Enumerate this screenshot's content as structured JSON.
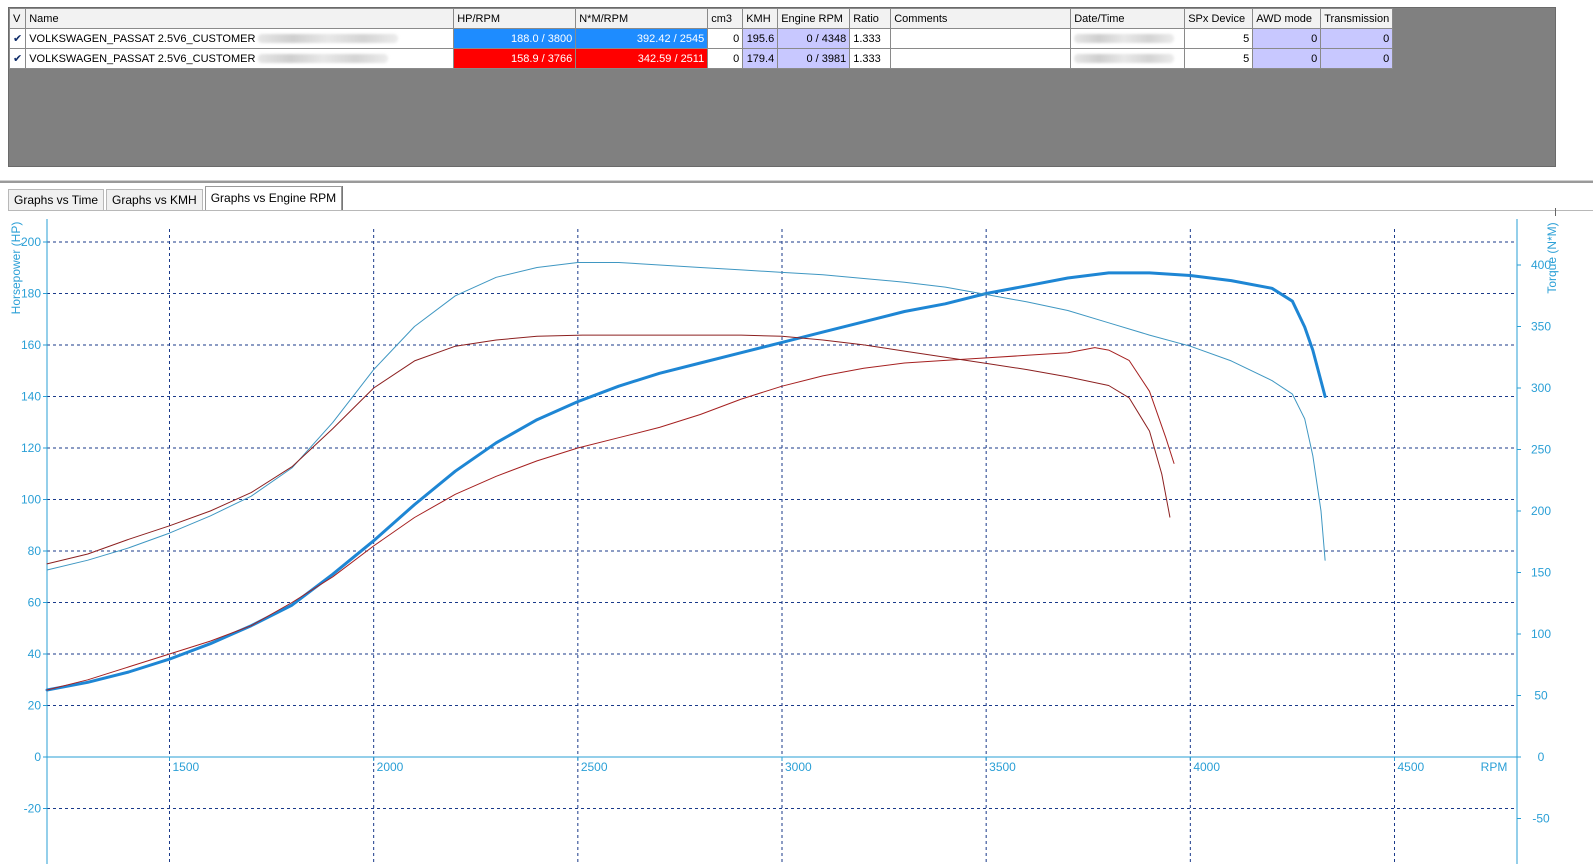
{
  "table": {
    "headers": [
      "V",
      "Name",
      "HP/RPM",
      "N*M/RPM",
      "cm3",
      "KMH",
      "Engine RPM",
      "Ratio",
      "Comments",
      "Date/Time",
      "SPx Device",
      "AWD mode",
      "Transmission"
    ],
    "rows": [
      {
        "checked": "✔",
        "name": "VOLKSWAGEN_PASSAT 2.5V6_CUSTOMER",
        "hp_rpm": "188.0 / 3800",
        "nm_rpm": "392.42 / 2545",
        "cm3": "0",
        "kmh": "195.6",
        "engine_rpm": "0 / 4348",
        "ratio": "1.333",
        "comments": "",
        "spx_device": "5",
        "awd_mode": "0",
        "transmission": "0",
        "color": "#1e8cff"
      },
      {
        "checked": "✔",
        "name": "VOLKSWAGEN_PASSAT 2.5V6_CUSTOMER",
        "hp_rpm": "158.9 / 3766",
        "nm_rpm": "342.59 / 2511",
        "cm3": "0",
        "kmh": "179.4",
        "engine_rpm": "0 / 3981",
        "ratio": "1.333",
        "comments": "",
        "spx_device": "5",
        "awd_mode": "0",
        "transmission": "0",
        "color": "#ff0000"
      }
    ]
  },
  "tabs": [
    {
      "label": "Graphs vs Time",
      "active": false
    },
    {
      "label": "Graphs vs KMH",
      "active": false
    },
    {
      "label": "Graphs vs Engine RPM",
      "active": true
    }
  ],
  "chart_data": {
    "type": "line",
    "xlabel": "RPM",
    "ylabel_left": "Horsepower (HP)",
    "ylabel_right": "Torque (N*M)",
    "xlim": [
      1200,
      4800
    ],
    "ylim_left": [
      -35,
      205
    ],
    "ylim_right": [
      -70,
      425
    ],
    "x_ticks": [
      "1500",
      "2000",
      "2500",
      "3000",
      "3500",
      "4000",
      "4500"
    ],
    "y_ticks_left": [
      "-20",
      "0",
      "20",
      "40",
      "60",
      "80",
      "100",
      "120",
      "140",
      "160",
      "180",
      "200"
    ],
    "y_ticks_right": [
      "-50",
      "0",
      "50",
      "100",
      "150",
      "200",
      "250",
      "300",
      "350",
      "400"
    ],
    "grid": true,
    "grid_color": "#1a3a8a",
    "axis_text_color": "#2a9fd6",
    "series": [
      {
        "axis": "left",
        "color": "#1e86d4",
        "width": 3,
        "points": [
          [
            1200,
            26
          ],
          [
            1300,
            29
          ],
          [
            1400,
            33
          ],
          [
            1500,
            38
          ],
          [
            1600,
            44
          ],
          [
            1700,
            51
          ],
          [
            1800,
            59
          ],
          [
            1900,
            71
          ],
          [
            2000,
            84
          ],
          [
            2100,
            98
          ],
          [
            2200,
            111
          ],
          [
            2300,
            122
          ],
          [
            2400,
            131
          ],
          [
            2500,
            138
          ],
          [
            2600,
            144
          ],
          [
            2700,
            149
          ],
          [
            2800,
            153
          ],
          [
            2900,
            157
          ],
          [
            3000,
            161
          ],
          [
            3100,
            165
          ],
          [
            3200,
            169
          ],
          [
            3300,
            173
          ],
          [
            3400,
            176
          ],
          [
            3500,
            180
          ],
          [
            3600,
            183
          ],
          [
            3700,
            186
          ],
          [
            3800,
            188
          ],
          [
            3900,
            188
          ],
          [
            4000,
            187
          ],
          [
            4100,
            185
          ],
          [
            4200,
            182
          ],
          [
            4250,
            177
          ],
          [
            4280,
            167
          ],
          [
            4300,
            158
          ],
          [
            4320,
            146
          ],
          [
            4330,
            140
          ]
        ]
      },
      {
        "axis": "left",
        "color": "#a52020",
        "width": 1,
        "points": [
          [
            1200,
            26
          ],
          [
            1300,
            30
          ],
          [
            1400,
            35
          ],
          [
            1500,
            40
          ],
          [
            1600,
            45
          ],
          [
            1700,
            51
          ],
          [
            1800,
            60
          ],
          [
            1900,
            70
          ],
          [
            2000,
            82
          ],
          [
            2100,
            93
          ],
          [
            2200,
            102
          ],
          [
            2300,
            109
          ],
          [
            2400,
            115
          ],
          [
            2500,
            120
          ],
          [
            2600,
            124
          ],
          [
            2700,
            128
          ],
          [
            2800,
            133
          ],
          [
            2900,
            139
          ],
          [
            3000,
            144
          ],
          [
            3100,
            148
          ],
          [
            3200,
            151
          ],
          [
            3300,
            153
          ],
          [
            3400,
            154
          ],
          [
            3500,
            155
          ],
          [
            3600,
            156
          ],
          [
            3700,
            157
          ],
          [
            3766,
            159
          ],
          [
            3800,
            158
          ],
          [
            3850,
            154
          ],
          [
            3900,
            142
          ],
          [
            3940,
            124
          ],
          [
            3960,
            114
          ]
        ]
      },
      {
        "axis": "right",
        "color": "#3f97c2",
        "width": 1,
        "points": [
          [
            1200,
            152
          ],
          [
            1300,
            160
          ],
          [
            1400,
            170
          ],
          [
            1500,
            182
          ],
          [
            1600,
            196
          ],
          [
            1700,
            212
          ],
          [
            1800,
            235
          ],
          [
            1900,
            272
          ],
          [
            2000,
            315
          ],
          [
            2100,
            350
          ],
          [
            2200,
            375
          ],
          [
            2300,
            390
          ],
          [
            2400,
            398
          ],
          [
            2500,
            402
          ],
          [
            2545,
            402
          ],
          [
            2600,
            402
          ],
          [
            2700,
            400
          ],
          [
            2800,
            398
          ],
          [
            2900,
            396
          ],
          [
            3000,
            394
          ],
          [
            3100,
            392
          ],
          [
            3200,
            389
          ],
          [
            3300,
            386
          ],
          [
            3400,
            382
          ],
          [
            3500,
            376
          ],
          [
            3600,
            370
          ],
          [
            3700,
            363
          ],
          [
            3800,
            353
          ],
          [
            3900,
            343
          ],
          [
            4000,
            334
          ],
          [
            4100,
            322
          ],
          [
            4200,
            306
          ],
          [
            4250,
            295
          ],
          [
            4280,
            275
          ],
          [
            4300,
            245
          ],
          [
            4320,
            200
          ],
          [
            4330,
            160
          ]
        ]
      },
      {
        "axis": "right",
        "color": "#8c2020",
        "width": 1,
        "points": [
          [
            1200,
            157
          ],
          [
            1300,
            165
          ],
          [
            1400,
            177
          ],
          [
            1500,
            188
          ],
          [
            1600,
            200
          ],
          [
            1700,
            215
          ],
          [
            1800,
            236
          ],
          [
            1900,
            267
          ],
          [
            2000,
            300
          ],
          [
            2100,
            322
          ],
          [
            2200,
            334
          ],
          [
            2300,
            339
          ],
          [
            2400,
            342
          ],
          [
            2511,
            343
          ],
          [
            2600,
            343
          ],
          [
            2700,
            343
          ],
          [
            2800,
            343
          ],
          [
            2900,
            343
          ],
          [
            3000,
            342
          ],
          [
            3100,
            339
          ],
          [
            3200,
            335
          ],
          [
            3300,
            330
          ],
          [
            3400,
            325
          ],
          [
            3500,
            320
          ],
          [
            3600,
            315
          ],
          [
            3700,
            309
          ],
          [
            3800,
            302
          ],
          [
            3850,
            292
          ],
          [
            3900,
            265
          ],
          [
            3930,
            230
          ],
          [
            3950,
            195
          ]
        ]
      }
    ]
  }
}
